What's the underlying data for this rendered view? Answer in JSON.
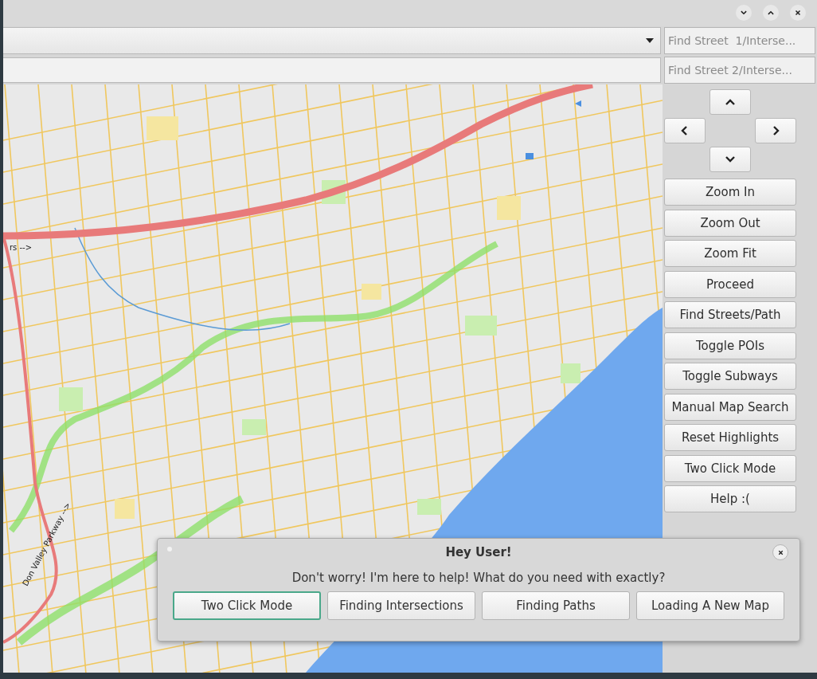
{
  "street_fields": [
    {
      "placeholder": "Find Street  1/Interse..."
    },
    {
      "placeholder": "Find Street 2/Interse..."
    }
  ],
  "map": {
    "labels": [
      {
        "kind": "west",
        "text": "rs -->"
      },
      {
        "kind": "parkway",
        "text": "Don Valley Parkway -->"
      }
    ]
  },
  "nav_buttons": [
    "Zoom In",
    "Zoom Out",
    "Zoom Fit",
    "Proceed",
    "Find Streets/Path",
    "Toggle POIs",
    "Toggle Subways",
    "Manual Map Search",
    "Reset Highlights",
    "Two Click Mode",
    "Help :("
  ],
  "dialog": {
    "title": "Hey User!",
    "message": "Don't worry! I'm here to help! What do you need with exactly?",
    "buttons": [
      {
        "label": "Two Click Mode",
        "selected": true
      },
      {
        "label": "Finding Intersections",
        "selected": false
      },
      {
        "label": "Finding Paths",
        "selected": false
      },
      {
        "label": "Loading A New Map",
        "selected": false
      }
    ]
  }
}
